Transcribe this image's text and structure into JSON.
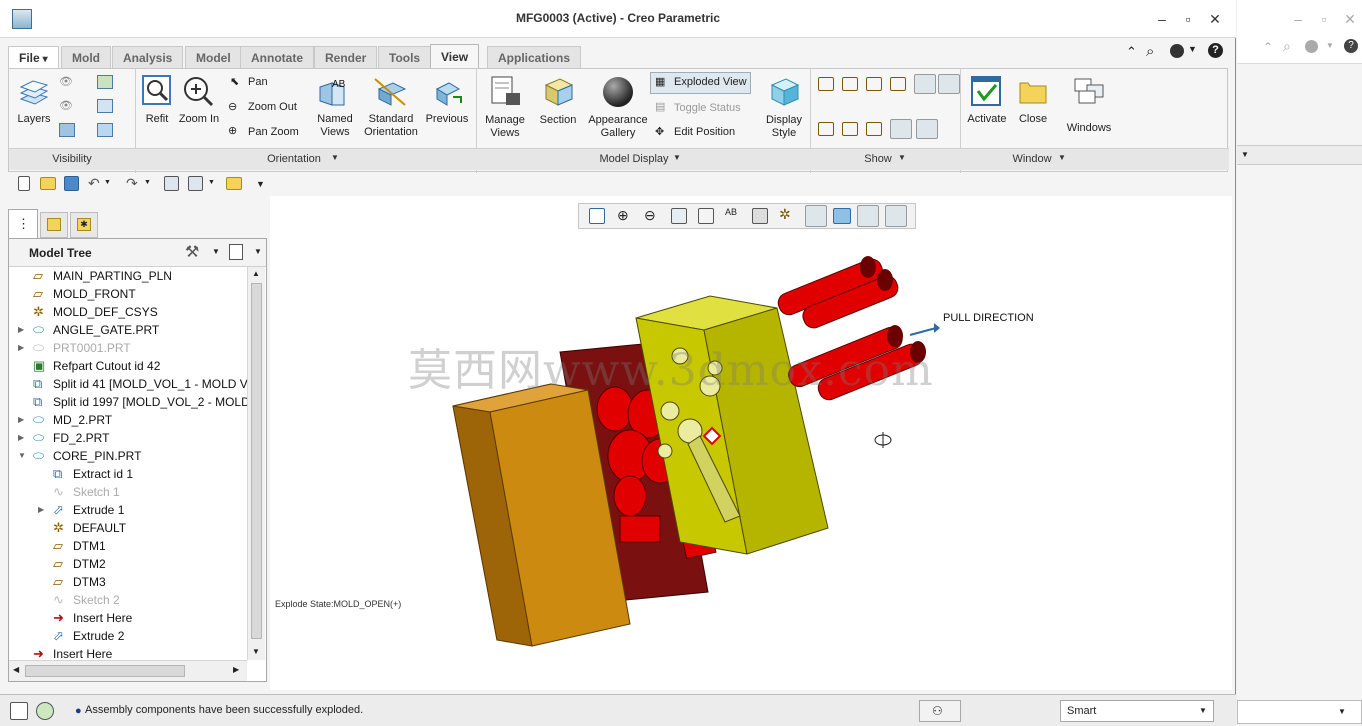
{
  "window": {
    "title": "MFG0003 (Active) - Creo Parametric"
  },
  "tabs": [
    "File",
    "Mold",
    "Analysis",
    "Model",
    "Annotate",
    "Render",
    "Tools",
    "View",
    "Applications"
  ],
  "ribbon": {
    "visibility": {
      "layers": "Layers",
      "label": "Visibility"
    },
    "orientation": {
      "refit": "Refit",
      "zoom_in": "Zoom In",
      "pan": "Pan",
      "zoom_out": "Zoom Out",
      "pan_zoom": "Pan Zoom",
      "named_views": "Named\nViews",
      "standard_orientation": "Standard\nOrientation",
      "previous": "Previous",
      "label": "Orientation"
    },
    "model_display": {
      "manage_views": "Manage\nViews",
      "section": "Section",
      "appearance_gallery": "Appearance\nGallery",
      "exploded_view": "Exploded View",
      "toggle_status": "Toggle Status",
      "edit_position": "Edit Position",
      "display_style": "Display\nStyle",
      "label": "Model Display"
    },
    "show": {
      "label": "Show"
    },
    "window": {
      "activate": "Activate",
      "close": "Close",
      "windows": "Windows",
      "label": "Window"
    }
  },
  "model_tree": {
    "header": "Model Tree",
    "items": [
      {
        "label": "MAIN_PARTING_PLN",
        "icon": "datum-plane-icon",
        "indent": 0,
        "expand": false,
        "disabled": false
      },
      {
        "label": "MOLD_FRONT",
        "icon": "datum-plane-icon",
        "indent": 0,
        "expand": false,
        "disabled": false
      },
      {
        "label": "MOLD_DEF_CSYS",
        "icon": "csys-icon",
        "indent": 0,
        "expand": false,
        "disabled": false
      },
      {
        "label": "ANGLE_GATE.PRT",
        "icon": "part-icon",
        "indent": 0,
        "expand": true,
        "disabled": false
      },
      {
        "label": "PRT0001.PRT",
        "icon": "part-icon",
        "indent": 0,
        "expand": true,
        "disabled": true
      },
      {
        "label": "Refpart Cutout id 42",
        "icon": "cutout-icon",
        "indent": 0,
        "expand": false,
        "disabled": false
      },
      {
        "label": "Split id 41 [MOLD_VOL_1 - MOLD V",
        "icon": "split-icon",
        "indent": 0,
        "expand": false,
        "disabled": false
      },
      {
        "label": "Split id 1997 [MOLD_VOL_2 - MOLD",
        "icon": "split-icon",
        "indent": 0,
        "expand": false,
        "disabled": false
      },
      {
        "label": "MD_2.PRT",
        "icon": "part-icon",
        "indent": 0,
        "expand": true,
        "disabled": false
      },
      {
        "label": "FD_2.PRT",
        "icon": "part-icon",
        "indent": 0,
        "expand": true,
        "disabled": false
      },
      {
        "label": "CORE_PIN.PRT",
        "icon": "part-icon",
        "indent": 0,
        "expand": true,
        "open": true,
        "disabled": false
      },
      {
        "label": "Extract id 1",
        "icon": "extract-icon",
        "indent": 1,
        "expand": false,
        "disabled": false
      },
      {
        "label": "Sketch 1",
        "icon": "sketch-icon",
        "indent": 1,
        "expand": false,
        "disabled": true
      },
      {
        "label": "Extrude 1",
        "icon": "extrude-icon",
        "indent": 1,
        "expand": true,
        "disabled": false
      },
      {
        "label": "DEFAULT",
        "icon": "csys-icon",
        "indent": 1,
        "expand": false,
        "disabled": false
      },
      {
        "label": "DTM1",
        "icon": "datum-plane-icon",
        "indent": 1,
        "expand": false,
        "disabled": false
      },
      {
        "label": "DTM2",
        "icon": "datum-plane-icon",
        "indent": 1,
        "expand": false,
        "disabled": false
      },
      {
        "label": "DTM3",
        "icon": "datum-plane-icon",
        "indent": 1,
        "expand": false,
        "disabled": false
      },
      {
        "label": "Sketch 2",
        "icon": "sketch-icon",
        "indent": 1,
        "expand": false,
        "disabled": true
      },
      {
        "label": "Insert Here",
        "icon": "insert-arrow-icon",
        "indent": 1,
        "expand": false,
        "disabled": false
      },
      {
        "label": "Extrude 2",
        "icon": "extrude-icon",
        "indent": 1,
        "expand": false,
        "disabled": false
      },
      {
        "label": "Insert Here",
        "icon": "insert-arrow-icon",
        "indent": 0,
        "expand": false,
        "disabled": false
      }
    ]
  },
  "viewport": {
    "pull_direction": "PULL DIRECTION",
    "explode_state": "Explode State:MOLD_OPEN(+)",
    "watermark": "莫西网www.3dmox.com"
  },
  "status": {
    "message": "Assembly components have been successfully exploded.",
    "filter": "Smart"
  },
  "colors": {
    "accent": "#3a78b8",
    "mold_orange": "#c8820a",
    "mold_yellow": "#c8c800",
    "mold_red": "#e80000"
  }
}
